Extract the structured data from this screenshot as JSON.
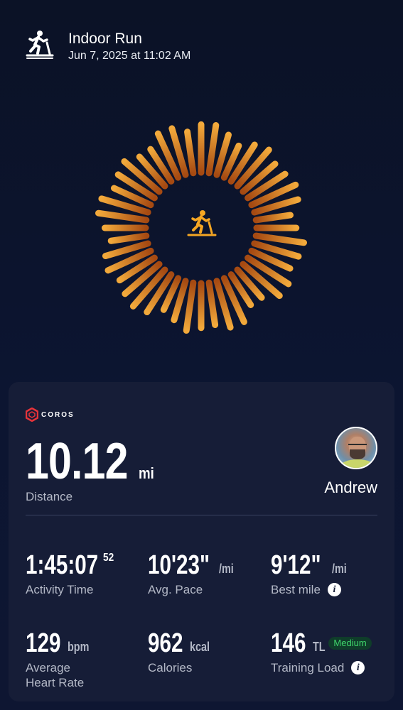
{
  "header": {
    "title": "Indoor Run",
    "subtitle": "Jun 7, 2025 at 11:02 AM",
    "icon": "treadmill-icon"
  },
  "ring": {
    "center_icon": "treadmill-icon",
    "colors": {
      "outer": "#f2a93b",
      "inner": "#a64a12"
    }
  },
  "card": {
    "brand": {
      "logo_icon": "coros-hex-icon",
      "name": "COROS",
      "color": "#e8333a"
    },
    "distance": {
      "value": "10.12",
      "unit": "mi",
      "label": "Distance"
    },
    "user": {
      "name": "Andrew",
      "avatar": "avatar-photo"
    },
    "stats": [
      {
        "value": "1:45:07",
        "sup": "52",
        "unit": "",
        "label": "Activity Time"
      },
      {
        "value": "10'23\"",
        "sup": "",
        "unit": "/mi",
        "label": "Avg. Pace"
      },
      {
        "value": "9'12\"",
        "sup": "",
        "unit": "/mi",
        "label": "Best mile",
        "info_icon": "info-icon"
      },
      {
        "value": "129",
        "sup": "",
        "unit": "bpm",
        "label_line1": "Average",
        "label_line2": "Heart Rate"
      },
      {
        "value": "962",
        "sup": "",
        "unit": "kcal",
        "label": "Calories"
      },
      {
        "value": "146",
        "sup": "",
        "unit": "TL",
        "badge": "Medium",
        "label": "Training Load",
        "info_icon": "info-icon"
      }
    ],
    "badge_colors": {
      "bg": "#0f3d2a",
      "text": "#3fd46b"
    }
  }
}
